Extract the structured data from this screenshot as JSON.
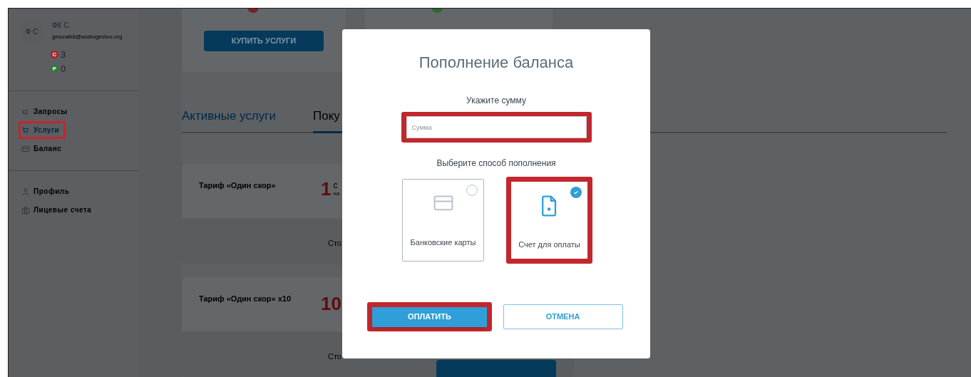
{
  "sidebar": {
    "avatar_initials": "Ф С",
    "user_name": "ФК С.",
    "email": "gmuratidi@sodrugestvo.org",
    "counters": [
      {
        "letter": "С",
        "value": "3",
        "color": "#a3262b"
      },
      {
        "letter": "Р",
        "value": "0",
        "color": "#2a7a35"
      }
    ],
    "nav_groups": [
      [
        {
          "label": "Запросы",
          "highlighted": false
        },
        {
          "label": "Услуги",
          "highlighted": true
        },
        {
          "label": "Баланс",
          "highlighted": false
        }
      ],
      [
        {
          "label": "Профиль",
          "highlighted": false
        },
        {
          "label": "Лицевые счета",
          "highlighted": false
        }
      ]
    ]
  },
  "main": {
    "buy_button": "КУПИТЬ УСЛУГИ",
    "tabs": [
      {
        "label": "Активные услуги",
        "selected": false
      },
      {
        "label": "Поку",
        "selected": true
      }
    ],
    "tariffs": [
      {
        "name": "Тариф «Один скор»",
        "amount": "1",
        "unit": "с",
        "unit_sub": "на",
        "price_label": "Сто"
      },
      {
        "name": "Тариф «Один скор» x10",
        "amount": "10",
        "price_label": "Сто",
        "button_visible": true
      }
    ]
  },
  "modal": {
    "title": "Пополнение баланса",
    "amount_label": "Укажите сумму",
    "amount_field": {
      "placeholder": "Сумма",
      "highlighted": true
    },
    "method_label": "Выберите способ пополнения",
    "methods": [
      {
        "label": "Банковские карты",
        "selected": false,
        "highlighted": false
      },
      {
        "label": "Счет для оплаты",
        "selected": true,
        "highlighted": true
      }
    ],
    "buttons": [
      {
        "label": "ОПЛАТИТЬ",
        "kind": "primary",
        "highlighted": true
      },
      {
        "label": "ОТМЕНА",
        "kind": "secondary",
        "highlighted": false
      }
    ]
  }
}
